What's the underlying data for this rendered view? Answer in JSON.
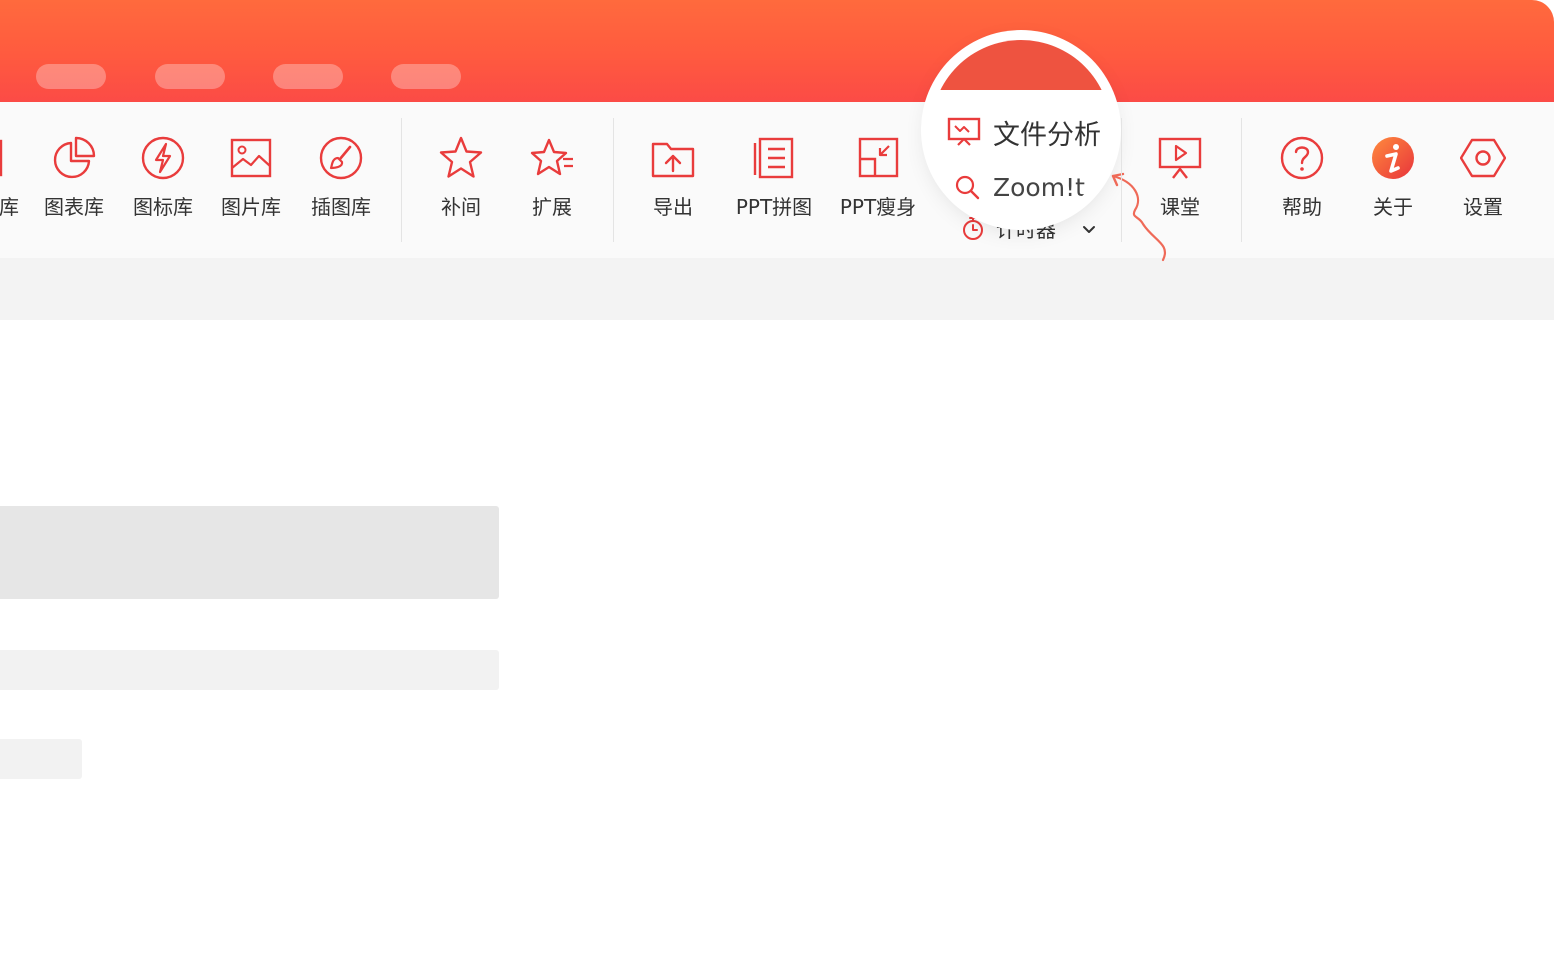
{
  "colors": {
    "accent": "#e93c3c",
    "titlebar": "#ff5f3f",
    "text": "#333333"
  },
  "toolbar": {
    "partial_first_label": "库",
    "group1": [
      {
        "label": "图表库",
        "icon": "pie-chart-icon"
      },
      {
        "label": "图标库",
        "icon": "lightning-icon"
      },
      {
        "label": "图片库",
        "icon": "image-icon"
      },
      {
        "label": "插图库",
        "icon": "brush-icon"
      }
    ],
    "group2": [
      {
        "label": "补间",
        "icon": "star-icon"
      },
      {
        "label": "扩展",
        "icon": "star-list-icon"
      }
    ],
    "group3": [
      {
        "label": "导出",
        "icon": "folder-upload-icon"
      },
      {
        "label": "PPT拼图",
        "icon": "document-list-icon"
      },
      {
        "label": "PPT瘦身",
        "icon": "shrink-icon"
      }
    ],
    "lens_items": {
      "file_analysis": "文件分析",
      "zoom": "Zoom!t",
      "timer": "计时器"
    },
    "group4": [
      {
        "label": "课堂",
        "icon": "presentation-icon"
      }
    ],
    "group5": [
      {
        "label": "帮助",
        "icon": "question-icon"
      },
      {
        "label": "关于",
        "icon": "info-icon"
      },
      {
        "label": "设置",
        "icon": "hexagon-gear-icon"
      }
    ]
  }
}
